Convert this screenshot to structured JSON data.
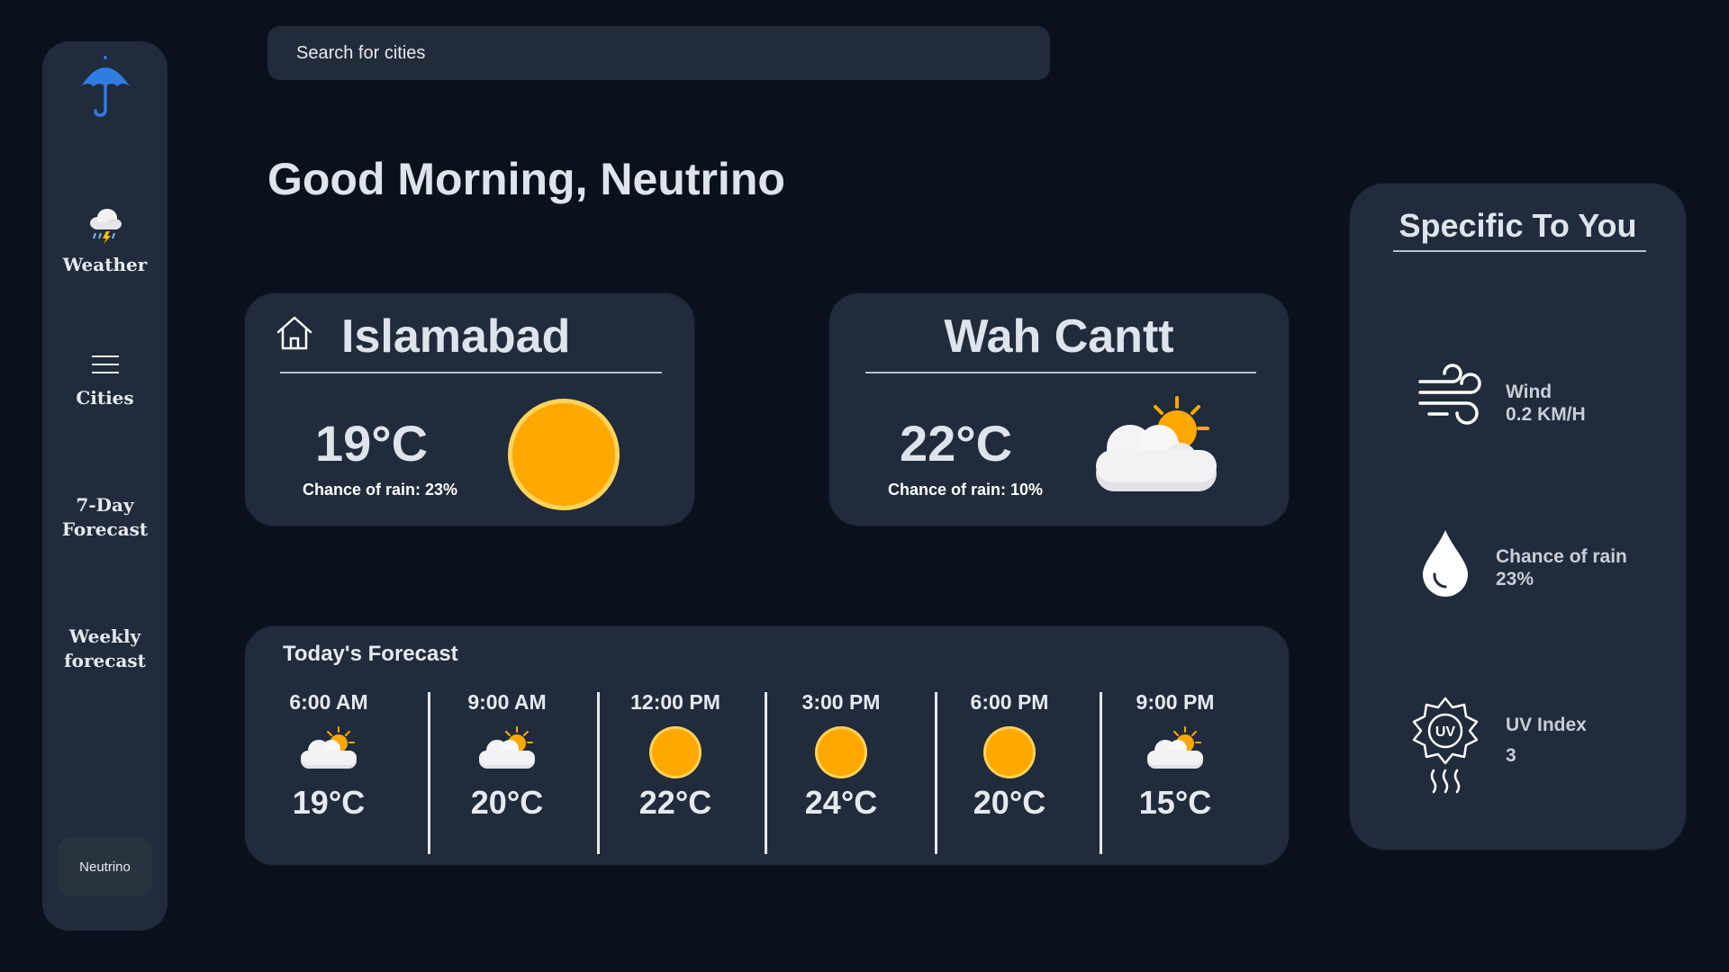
{
  "sidebar": {
    "logo_icon": "umbrella-icon",
    "items": [
      {
        "label": "Weather",
        "icon": "cloud-rain-icon"
      },
      {
        "label": "Cities",
        "icon": "menu-icon"
      },
      {
        "label": "7-Day Forecast"
      },
      {
        "label": "Weekly forecast"
      }
    ],
    "user": "Neutrino"
  },
  "search": {
    "placeholder": "Search for cities"
  },
  "greeting": "Good Morning, Neutrino",
  "cities": [
    {
      "name": "Islamabad",
      "icon": "home-icon",
      "temp": "19°C",
      "rain": "Chance of rain: 23%",
      "condition": "sun-icon"
    },
    {
      "name": "Wah Cantt",
      "temp": "22°C",
      "rain": "Chance of rain: 10%",
      "condition": "partly-cloudy-icon"
    }
  ],
  "today": {
    "title": "Today's Forecast",
    "slots": [
      {
        "time": "6:00 AM",
        "temp": "19°C",
        "icon": "partly-cloudy-icon"
      },
      {
        "time": "9:00 AM",
        "temp": "20°C",
        "icon": "partly-cloudy-icon"
      },
      {
        "time": "12:00 PM",
        "temp": "22°C",
        "icon": "sun-icon"
      },
      {
        "time": "3:00 PM",
        "temp": "24°C",
        "icon": "sun-icon"
      },
      {
        "time": "6:00 PM",
        "temp": "20°C",
        "icon": "sun-icon"
      },
      {
        "time": "9:00 PM",
        "temp": "15°C",
        "icon": "partly-cloudy-icon"
      }
    ]
  },
  "specific": {
    "title": "Specific To You",
    "wind": {
      "label": "Wind",
      "value": "0.2 KM/H",
      "icon": "wind-icon"
    },
    "rain": {
      "label": "Chance of rain",
      "value": "23%",
      "icon": "raindrop-icon"
    },
    "uv": {
      "label": "UV Index",
      "value": "3",
      "icon": "uv-index-icon"
    }
  },
  "colors": {
    "background": "#0b111c",
    "card": "#202b3b",
    "sun": "#ffa800",
    "accent": "#2f7de1"
  }
}
